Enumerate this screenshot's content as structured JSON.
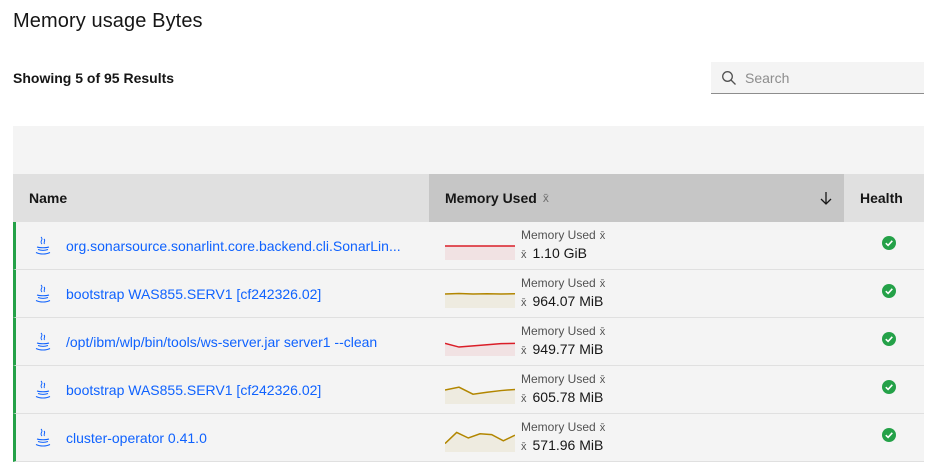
{
  "page_title": "Memory usage Bytes",
  "results_text": "Showing 5 of 95 Results",
  "search": {
    "placeholder": "Search",
    "value": ""
  },
  "table": {
    "columns": {
      "name": "Name",
      "memory": "Memory Used",
      "memory_symbol": "x̄",
      "health": "Health"
    },
    "metric_label": "Memory Used",
    "mean_symbol": "x̄",
    "rows": [
      {
        "name": "org.sonarsource.sonarlint.core.backend.cli.SonarLin...",
        "value": "1.10 GiB",
        "spark_color": "#da1e28",
        "spark_points": [
          0.5,
          0.5,
          0.5
        ],
        "health": "healthy"
      },
      {
        "name": "bootstrap WAS855.SERV1 [cf242326.02]",
        "value": "964.07 MiB",
        "spark_color": "#b28600",
        "spark_points": [
          0.5,
          0.48,
          0.5,
          0.49,
          0.5,
          0.49
        ],
        "health": "healthy"
      },
      {
        "name": "/opt/ibm/wlp/bin/tools/ws-server.jar server1 --clean",
        "value": "949.77 MiB",
        "spark_color": "#da1e28",
        "spark_points": [
          0.55,
          0.68,
          0.64,
          0.6,
          0.56,
          0.55
        ],
        "health": "healthy"
      },
      {
        "name": "bootstrap WAS855.SERV1 [cf242326.02]",
        "value": "605.78 MiB",
        "spark_color": "#b28600",
        "spark_points": [
          0.5,
          0.4,
          0.65,
          0.58,
          0.52,
          0.48
        ],
        "health": "healthy"
      },
      {
        "name": "cluster-operator 0.41.0",
        "value": "571.96 MiB",
        "spark_color": "#b28600",
        "spark_points": [
          0.7,
          0.3,
          0.5,
          0.35,
          0.38,
          0.6,
          0.4
        ],
        "health": "healthy"
      }
    ]
  },
  "colors": {
    "link": "#0f62fe",
    "healthy": "#24a148",
    "row_border": "#24a148"
  }
}
